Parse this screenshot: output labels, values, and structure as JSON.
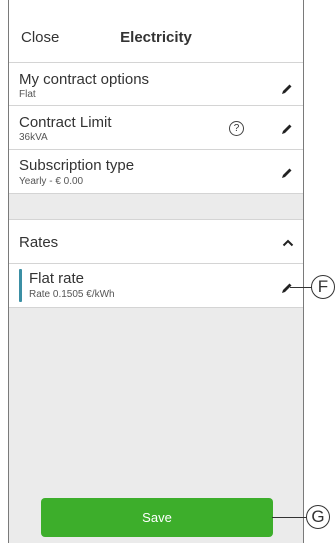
{
  "header": {
    "close_label": "Close",
    "title": "Electricity"
  },
  "options": [
    {
      "label": "My contract options",
      "value": "Flat"
    },
    {
      "label": "Contract Limit",
      "value": "36kVA",
      "help": "?"
    },
    {
      "label": "Subscription type",
      "value": "Yearly - € 0.00"
    }
  ],
  "rates": {
    "heading": "Rates",
    "items": [
      {
        "label": "Flat rate",
        "value": "Rate 0.1505 €/kWh"
      }
    ]
  },
  "save_label": "Save",
  "callouts": {
    "edit": "F",
    "save": "G"
  },
  "colors": {
    "accent": "#3dae2b",
    "rate_bar": "#3b8fa4",
    "background": "#ebebeb"
  },
  "icons": {
    "edit": "pencil-icon",
    "help": "question-circle-icon",
    "collapse": "chevron-up-icon"
  }
}
